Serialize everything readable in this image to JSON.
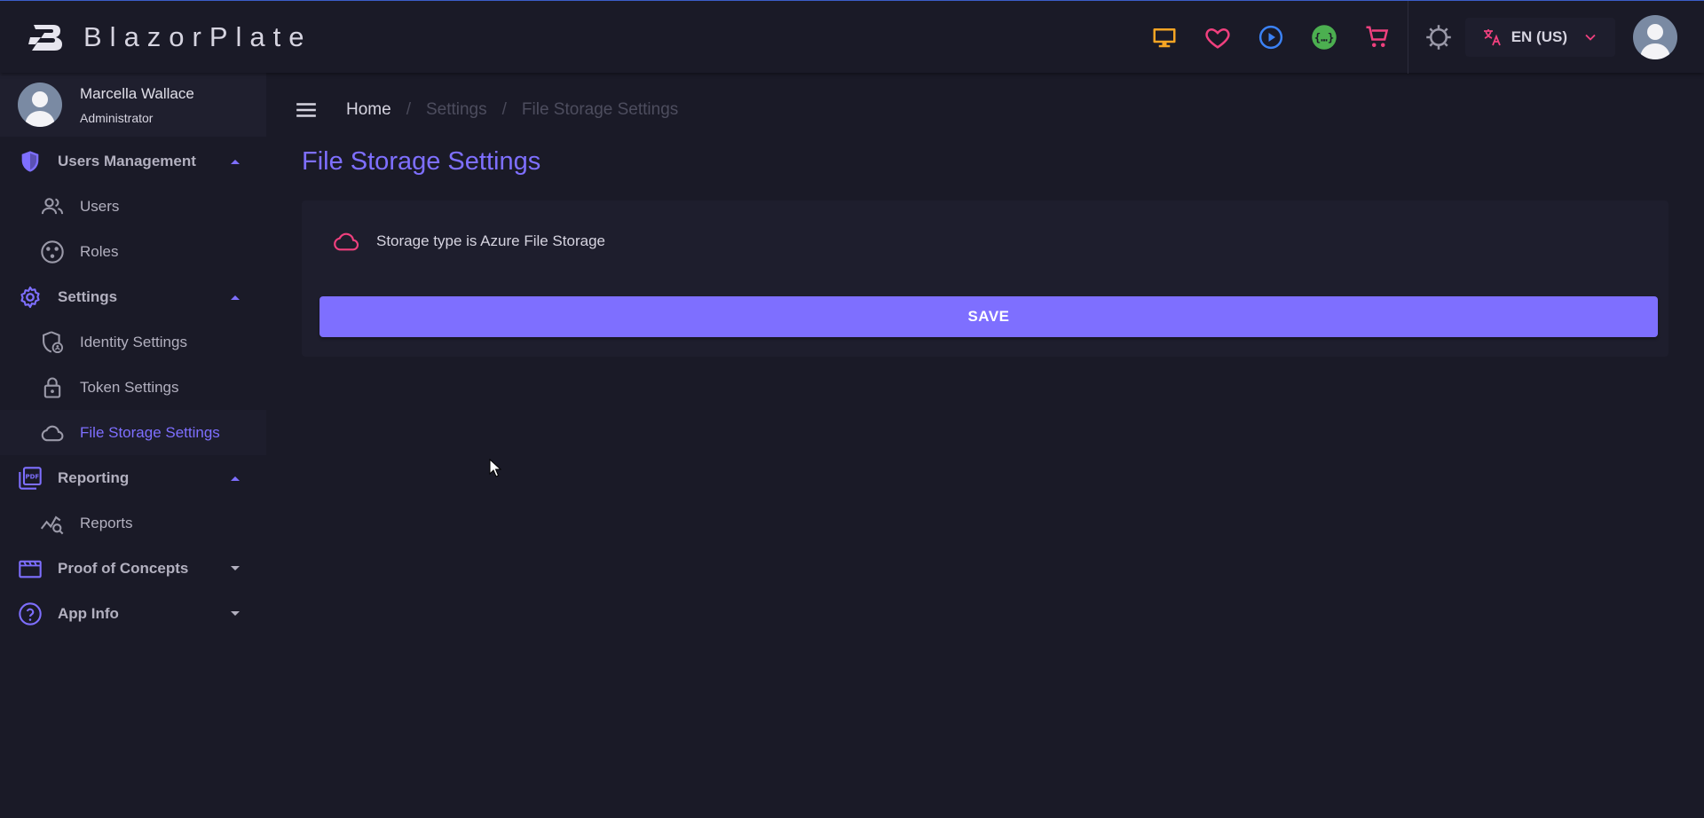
{
  "brand": {
    "name": "BlazorPlate"
  },
  "topbar": {
    "icons": [
      "monitor-icon",
      "heart-icon",
      "play-circle-icon",
      "api-icon",
      "cart-icon",
      "theme-icon"
    ],
    "language": "EN (US)",
    "colors": {
      "monitor": "#f5a524",
      "heart": "#f0407e",
      "play": "#3b82f6",
      "api": "#4caf50",
      "cart": "#f0407e",
      "translate": "#f0407e"
    }
  },
  "profile": {
    "name": "Marcella Wallace",
    "role": "Administrator"
  },
  "sidebar": {
    "groups": [
      {
        "label": "Users Management",
        "expanded": true,
        "items": [
          {
            "label": "Users"
          },
          {
            "label": "Roles"
          }
        ]
      },
      {
        "label": "Settings",
        "expanded": true,
        "items": [
          {
            "label": "Identity Settings"
          },
          {
            "label": "Token Settings"
          },
          {
            "label": "File Storage Settings",
            "active": true
          }
        ]
      },
      {
        "label": "Reporting",
        "expanded": true,
        "items": [
          {
            "label": "Reports"
          }
        ]
      },
      {
        "label": "Proof of Concepts",
        "expanded": false,
        "items": []
      },
      {
        "label": "App Info",
        "expanded": false,
        "items": []
      }
    ]
  },
  "breadcrumb": {
    "home": "Home",
    "settings": "Settings",
    "current": "File Storage Settings",
    "separator": "/"
  },
  "page": {
    "title": "File Storage Settings",
    "alert_text": "Storage type is Azure File Storage",
    "save_label": "SAVE"
  },
  "theme": {
    "accent": "#7e6fff",
    "background": "#1a1a27",
    "surface": "#1e1e2d",
    "alert_icon": "#f0407e"
  }
}
